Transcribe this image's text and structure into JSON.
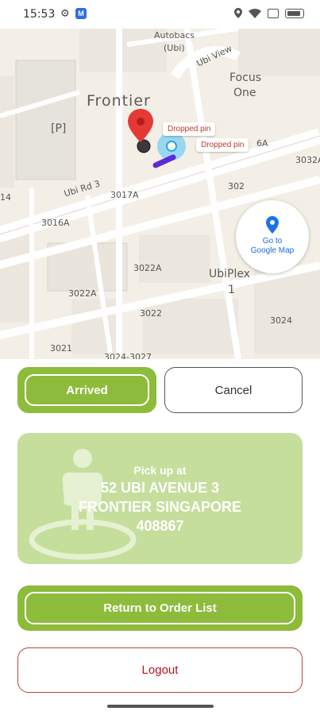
{
  "status_bar": {
    "time": "15:53",
    "icons": [
      "gear-icon",
      "app-notification-icon",
      "location-icon",
      "wifi-icon",
      "sim-icon",
      "battery-icon"
    ]
  },
  "map": {
    "labels": {
      "autobacs": "Autobacs",
      "ubi_paren": "(Ubi)",
      "ubi_view": "Ubi View",
      "focus": "Focus",
      "one": "One",
      "frontier": "Frontier",
      "parking": "[P]",
      "ubi_rd3": "Ubi Rd 3",
      "n3017a": "3017A",
      "n3016a": "3016A",
      "n14": "14",
      "n6a": "6A",
      "n3032a": "3032A",
      "n302": "302",
      "n3022a_1": "3022A",
      "n3022a_2": "3022A",
      "ubiplex": "UbiPlex",
      "ubiplex_1": "1",
      "n3022": "3022",
      "n3024": "3024",
      "n3021": "3021",
      "n3024_3027": "3024-3027"
    },
    "pins": {
      "dropped_pin_1": "Dropped pin",
      "dropped_pin_2": "Dropped pin"
    },
    "google_map_button": {
      "line1": "Go to",
      "line2": "Google Map"
    }
  },
  "actions": {
    "arrived_label": "Arrived",
    "cancel_label": "Cancel"
  },
  "pickup": {
    "label": "Pick up at",
    "address_line1": "52 UBI AVENUE 3",
    "address_line2": "FRONTIER SINGAPORE",
    "address_line3": "408867"
  },
  "footer": {
    "return_label": "Return to Order List",
    "logout_label": "Logout"
  },
  "colors": {
    "primary_green": "#8dbb3b",
    "card_green": "#c5de9c",
    "logout_red": "#b3161c",
    "map_bg": "#f3efe6",
    "pin_red": "#e53935",
    "link_blue": "#1a6cd6"
  }
}
